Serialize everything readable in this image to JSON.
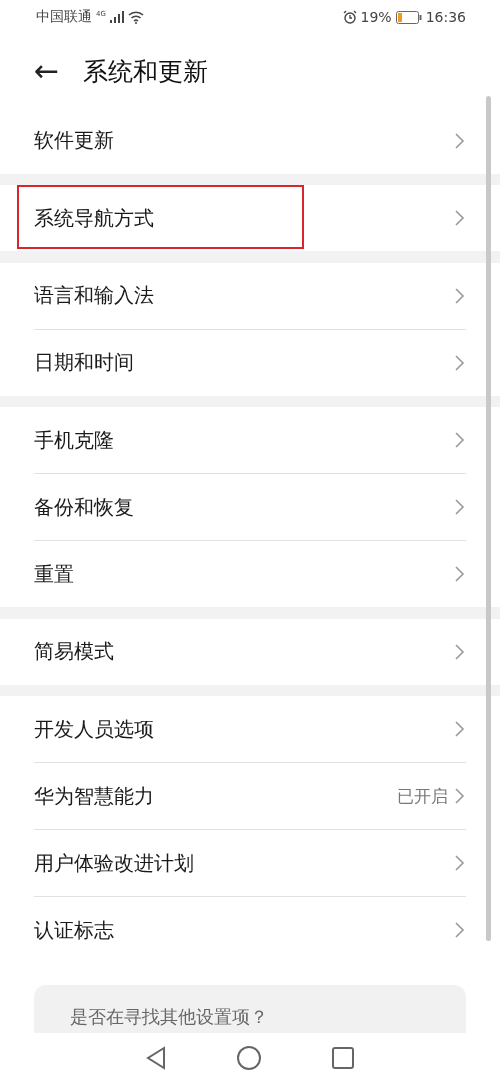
{
  "status_bar": {
    "carrier": "中国联通",
    "network": "4G",
    "battery": "19%",
    "time": "16:36"
  },
  "header": {
    "back": "←",
    "title": "系统和更新"
  },
  "groups": [
    {
      "items": [
        {
          "label": "软件更新",
          "highlighted": false
        }
      ]
    },
    {
      "items": [
        {
          "label": "系统导航方式",
          "highlighted": true
        }
      ]
    },
    {
      "items": [
        {
          "label": "语言和输入法",
          "highlighted": false
        },
        {
          "label": "日期和时间",
          "highlighted": false
        }
      ]
    },
    {
      "items": [
        {
          "label": "手机克隆",
          "highlighted": false
        },
        {
          "label": "备份和恢复",
          "highlighted": false
        },
        {
          "label": "重置",
          "highlighted": false
        }
      ]
    },
    {
      "items": [
        {
          "label": "简易模式",
          "highlighted": false
        }
      ]
    },
    {
      "items": [
        {
          "label": "开发人员选项",
          "highlighted": false
        },
        {
          "label": "华为智慧能力",
          "value": "已开启",
          "highlighted": false
        },
        {
          "label": "用户体验改进计划",
          "highlighted": false
        },
        {
          "label": "认证标志",
          "highlighted": false
        }
      ]
    }
  ],
  "suggestion_card": {
    "text": "是否在寻找其他设置项？"
  }
}
